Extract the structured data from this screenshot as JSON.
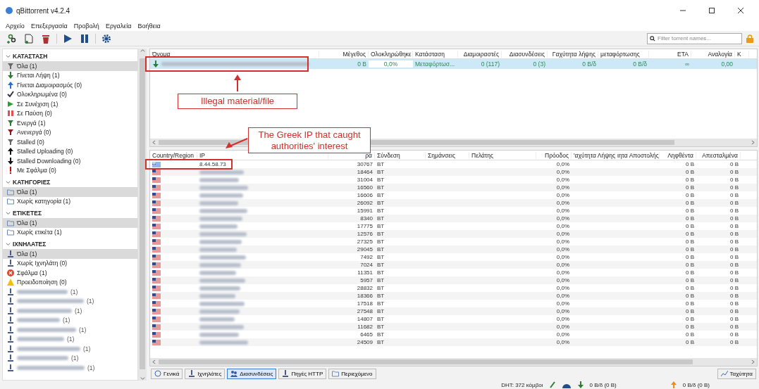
{
  "window": {
    "title": "qBittorrent v4.2.4"
  },
  "menu": [
    "Αρχείο",
    "Επεξεργασία",
    "Προβολή",
    "Εργαλεία",
    "Βοήθεια"
  ],
  "search": {
    "placeholder": "Filter torrent names..."
  },
  "sidebar": [
    {
      "title": "ΚΑΤΑΣΤΑΣΗ",
      "expanded": true,
      "items": [
        {
          "label": "Όλα (1)",
          "kind": "all",
          "selected": true
        },
        {
          "label": "Γίνεται Λήψη (1)",
          "kind": "downloading",
          "selected": false
        },
        {
          "label": "Γίνεται Διαμοιρασμός (0)",
          "kind": "seeding",
          "selected": false
        },
        {
          "label": "Ολοκληρωμένα (0)",
          "kind": "completed",
          "selected": false
        },
        {
          "label": "Σε Συνέχιση (1)",
          "kind": "resumed",
          "selected": false
        },
        {
          "label": "Σε Παύση (0)",
          "kind": "paused",
          "selected": false
        },
        {
          "label": "Ενεργά (1)",
          "kind": "active",
          "selected": false
        },
        {
          "label": "Ανενεργά (0)",
          "kind": "inactive",
          "selected": false
        },
        {
          "label": "Stalled (0)",
          "kind": "all",
          "selected": false
        },
        {
          "label": "Stalled Uploading (0)",
          "kind": "stalledup",
          "selected": false
        },
        {
          "label": "Stalled Downloading (0)",
          "kind": "stalleddown",
          "selected": false
        },
        {
          "label": "Με Σφάλμα (0)",
          "kind": "errored",
          "selected": false
        }
      ]
    },
    {
      "title": "ΚΑΤΗΓΟΡΙΕΣ",
      "expanded": true,
      "items": [
        {
          "label": "Όλα (1)",
          "kind": "folder",
          "selected": true
        },
        {
          "label": "Χωρίς κατηγορία (1)",
          "kind": "folder",
          "selected": false
        }
      ]
    },
    {
      "title": "ΕΤΙΚΕΤΕΣ",
      "expanded": true,
      "items": [
        {
          "label": "Όλα (1)",
          "kind": "folder",
          "selected": true
        },
        {
          "label": "Χωρίς ετικέτα (1)",
          "kind": "folder",
          "selected": false
        }
      ]
    },
    {
      "title": "ΙΧΝΗΛΑΤΕΣ",
      "expanded": true,
      "items": [
        {
          "label": "Όλα (1)",
          "kind": "tracker",
          "selected": true
        },
        {
          "label": "Χωρίς Ιχνηλάτη (0)",
          "kind": "tracker",
          "selected": false
        },
        {
          "label": "Σφάλμα (1)",
          "kind": "error",
          "selected": false
        },
        {
          "label": "Προειδοποίηση (0)",
          "kind": "warning",
          "selected": false
        },
        {
          "redacted": true,
          "count": "(1)",
          "kind": "tracker",
          "selected": false
        },
        {
          "redacted": true,
          "count": "(1)",
          "kind": "tracker",
          "selected": false
        },
        {
          "redacted": true,
          "count": "(1)",
          "kind": "tracker",
          "selected": false
        },
        {
          "redacted": true,
          "count": "(1)",
          "kind": "tracker",
          "selected": false
        },
        {
          "redacted": true,
          "count": "(1)",
          "kind": "tracker",
          "selected": false
        },
        {
          "redacted": true,
          "count": "(1)",
          "kind": "tracker",
          "selected": false
        },
        {
          "redacted": true,
          "count": "(1)",
          "kind": "tracker",
          "selected": false
        },
        {
          "redacted": true,
          "count": "(1)",
          "kind": "tracker",
          "selected": false
        },
        {
          "redacted": true,
          "count": "(1)",
          "kind": "tracker",
          "selected": false
        }
      ]
    }
  ],
  "torrents": {
    "columns": [
      "Όνομα",
      "Μέγεθος",
      "Ολοκληρώθηκε",
      "Κατάσταση",
      "Διαμοιραστές",
      "Διασυνδέσεις",
      "Γαχύτητα λήψης",
      "μεταφόρτωσης",
      "ETA",
      "Αναλογία",
      "Κ"
    ],
    "rows": [
      {
        "selected": true,
        "name_redacted": true,
        "cells": [
          "",
          "0 B",
          "0,0%",
          "Μεταφόρτωσ...",
          "0 (117)",
          "0 (3)",
          "0 B/δ",
          "0 B/δ",
          "∞",
          "0,00"
        ]
      }
    ]
  },
  "peers": {
    "columns": [
      "Country/Region",
      "IP",
      "ρα",
      "Σύνδεση",
      "Σημάνσεις",
      "Πελάτης",
      "Πρόοδος",
      "'αχύτητα Λήψης",
      "ιητα Αποστολής",
      "Ληφθέντα",
      "Απεσταλμένα"
    ],
    "rows": [
      {
        "kind": "greek",
        "ip": "8.44.58.73",
        "port": "30767",
        "connection": "BT",
        "progress": "0,0%",
        "downloaded": "0 B",
        "uploaded": "0 B"
      },
      {
        "kind": "us",
        "ip_redacted": true,
        "port": "18464",
        "connection": "BT",
        "progress": "0,0%",
        "downloaded": "0 B",
        "uploaded": "0 B"
      },
      {
        "kind": "us",
        "ip_redacted": true,
        "port": "31004",
        "connection": "BT",
        "progress": "0,0%",
        "downloaded": "0 B",
        "uploaded": "0 B"
      },
      {
        "kind": "us",
        "ip_redacted": true,
        "port": "16560",
        "connection": "BT",
        "progress": "0,0%",
        "downloaded": "0 B",
        "uploaded": "0 B"
      },
      {
        "kind": "us",
        "ip_redacted": true,
        "port": "16606",
        "connection": "BT",
        "progress": "0,0%",
        "downloaded": "0 B",
        "uploaded": "0 B"
      },
      {
        "kind": "us",
        "ip_redacted": true,
        "port": "26092",
        "connection": "BT",
        "progress": "0,0%",
        "downloaded": "0 B",
        "uploaded": "0 B"
      },
      {
        "kind": "us",
        "ip_redacted": true,
        "port": "15991",
        "connection": "BT",
        "progress": "0,0%",
        "downloaded": "0 B",
        "uploaded": "0 B"
      },
      {
        "kind": "us",
        "ip_redacted": true,
        "port": "8340",
        "connection": "BT",
        "progress": "0,0%",
        "downloaded": "0 B",
        "uploaded": "0 B"
      },
      {
        "kind": "us",
        "ip_redacted": true,
        "port": "17775",
        "connection": "BT",
        "progress": "0,0%",
        "downloaded": "0 B",
        "uploaded": "0 B"
      },
      {
        "kind": "us",
        "ip_redacted": true,
        "port": "12576",
        "connection": "BT",
        "progress": "0,0%",
        "downloaded": "0 B",
        "uploaded": "0 B"
      },
      {
        "kind": "us",
        "ip_redacted": true,
        "port": "27325",
        "connection": "BT",
        "progress": "0,0%",
        "downloaded": "0 B",
        "uploaded": "0 B"
      },
      {
        "kind": "us",
        "ip_redacted": true,
        "port": "29045",
        "connection": "BT",
        "progress": "0,0%",
        "downloaded": "0 B",
        "uploaded": "0 B"
      },
      {
        "kind": "us",
        "ip_redacted": true,
        "port": "7492",
        "connection": "BT",
        "progress": "0,0%",
        "downloaded": "0 B",
        "uploaded": "0 B"
      },
      {
        "kind": "us",
        "ip_redacted": true,
        "port": "7024",
        "connection": "BT",
        "progress": "0,0%",
        "downloaded": "0 B",
        "uploaded": "0 B"
      },
      {
        "kind": "us",
        "ip_redacted": true,
        "port": "11351",
        "connection": "BT",
        "progress": "0,0%",
        "downloaded": "0 B",
        "uploaded": "0 B"
      },
      {
        "kind": "us",
        "ip_redacted": true,
        "port": "5957",
        "connection": "BT",
        "progress": "0,0%",
        "downloaded": "0 B",
        "uploaded": "0 B"
      },
      {
        "kind": "us",
        "ip_redacted": true,
        "port": "28832",
        "connection": "BT",
        "progress": "0,0%",
        "downloaded": "0 B",
        "uploaded": "0 B"
      },
      {
        "kind": "us",
        "ip_redacted": true,
        "port": "18366",
        "connection": "BT",
        "progress": "0,0%",
        "downloaded": "0 B",
        "uploaded": "0 B"
      },
      {
        "kind": "us",
        "ip_redacted": true,
        "port": "17518",
        "connection": "BT",
        "progress": "0,0%",
        "downloaded": "0 B",
        "uploaded": "0 B"
      },
      {
        "kind": "us",
        "ip_redacted": true,
        "port": "27548",
        "connection": "BT",
        "progress": "0,0%",
        "downloaded": "0 B",
        "uploaded": "0 B"
      },
      {
        "kind": "us",
        "ip_redacted": true,
        "port": "14807",
        "connection": "BT",
        "progress": "0,0%",
        "downloaded": "0 B",
        "uploaded": "0 B"
      },
      {
        "kind": "us",
        "ip_redacted": true,
        "port": "11682",
        "connection": "BT",
        "progress": "0,0%",
        "downloaded": "0 B",
        "uploaded": "0 B"
      },
      {
        "kind": "us",
        "ip_redacted": true,
        "port": "6465",
        "connection": "BT",
        "progress": "0,0%",
        "downloaded": "0 B",
        "uploaded": "0 B"
      },
      {
        "kind": "us",
        "ip_redacted": true,
        "port": "24509",
        "connection": "BT",
        "progress": "0,0%",
        "downloaded": "0 B",
        "uploaded": "0 B"
      }
    ]
  },
  "detail_tabs": [
    {
      "label": "Γενικά",
      "kind": "info",
      "selected": false
    },
    {
      "label": "Ιχνηλάτες",
      "kind": "tracker",
      "selected": false
    },
    {
      "label": "Διασυνδέσεις",
      "kind": "peers",
      "selected": true
    },
    {
      "label": "Πηγές HTTP",
      "kind": "tracker",
      "selected": false
    },
    {
      "label": "Περιεχόμενο",
      "kind": "folder",
      "selected": false
    }
  ],
  "speed_button": "Ταχύτητα",
  "status_bar": {
    "dht": "DHT: 372 κόμβοι",
    "download": "0 B/δ (0 B)",
    "upload": "0 B/δ (0 B)"
  },
  "annotations": [
    {
      "kind": "torrent",
      "text": "Illegal material/file"
    },
    {
      "kind": "peer",
      "text": "The Greek IP that caught authorities' interest"
    }
  ]
}
